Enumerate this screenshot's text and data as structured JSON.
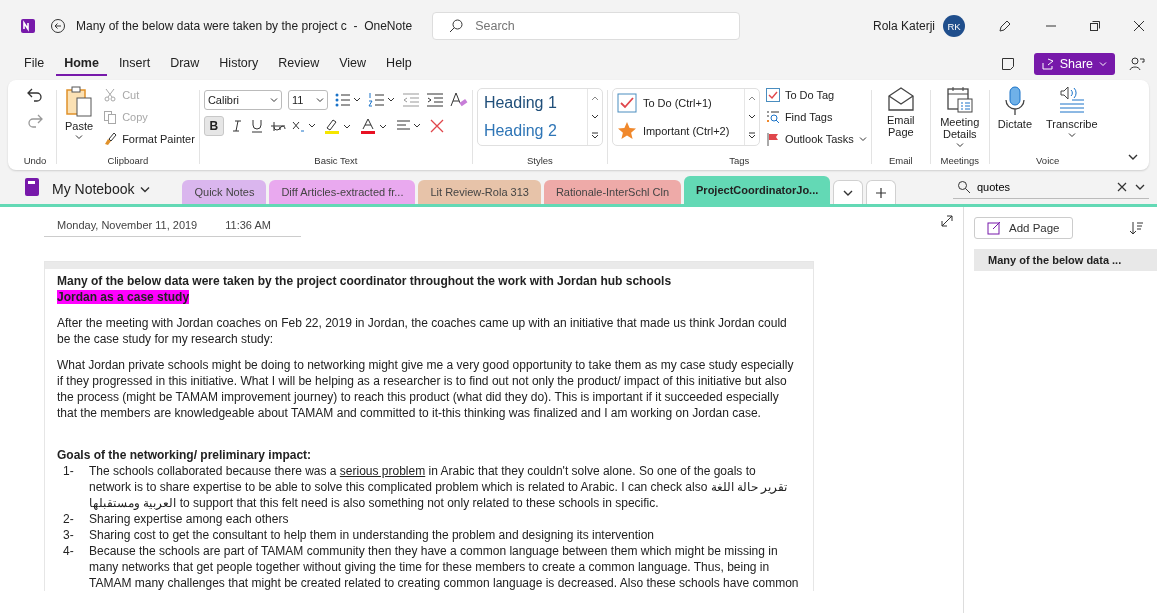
{
  "window": {
    "title": "Many of the below data were taken by the project c  -  OneNote",
    "user": "Rola Katerji",
    "avatar": "RK"
  },
  "search": {
    "placeholder": "Search"
  },
  "menu": [
    {
      "label": "File",
      "selected": false
    },
    {
      "label": "Home",
      "selected": true
    },
    {
      "label": "Insert",
      "selected": false
    },
    {
      "label": "Draw",
      "selected": false
    },
    {
      "label": "History",
      "selected": false
    },
    {
      "label": "Review",
      "selected": false
    },
    {
      "label": "View",
      "selected": false
    },
    {
      "label": "Help",
      "selected": false
    }
  ],
  "share": "Share",
  "undo": {
    "label": "Undo"
  },
  "clipboard": {
    "label": "Clipboard",
    "paste": "Paste",
    "items": [
      {
        "label": "Cut",
        "kind": "cut",
        "disabled": true
      },
      {
        "label": "Copy",
        "kind": "copy",
        "disabled": true
      },
      {
        "label": "Format Painter",
        "kind": "painter",
        "disabled": false
      }
    ]
  },
  "basic_text": {
    "label": "Basic Text",
    "font": "Calibri",
    "size": "11",
    "bold_label": "B",
    "bold_on": true
  },
  "styles": {
    "label": "Styles",
    "items": [
      "Heading 1",
      "Heading 2"
    ]
  },
  "tags": {
    "label": "Tags",
    "gallery": [
      {
        "label": "To Do (Ctrl+1)",
        "kind": "checkbox"
      },
      {
        "label": "Important (Ctrl+2)",
        "kind": "star"
      }
    ],
    "commands": [
      {
        "label": "To Do Tag",
        "kind": "todo"
      },
      {
        "label": "Find Tags",
        "kind": "find"
      },
      {
        "label": "Outlook Tasks",
        "kind": "flag"
      }
    ]
  },
  "email": {
    "label": "Email",
    "button": "Email Page"
  },
  "meetings": {
    "label": "Meetings",
    "button": "Meeting Details"
  },
  "voice": {
    "label": "Voice",
    "buttons": [
      {
        "label": "Dictate",
        "kind": "mic"
      },
      {
        "label": "Transcribe",
        "kind": "transcribe"
      }
    ]
  },
  "notebook": {
    "name": "My Notebook",
    "sections": [
      {
        "label": "Quick Notes",
        "color": "#dab6ee",
        "selected": false
      },
      {
        "label": "Diff Articles-extracted fr...",
        "color": "#e9a9ef",
        "selected": false
      },
      {
        "label": "Lit Review-Rola 313",
        "color": "#e7c3a9",
        "selected": false
      },
      {
        "label": "Rationale-InterSchl Cln",
        "color": "#eeaaa8",
        "selected": false
      },
      {
        "label": "ProjectCoordinatorJo...",
        "color": "#63d9b5",
        "selected": true
      }
    ]
  },
  "page_search": {
    "value": "quotes"
  },
  "page": {
    "date": "Monday, November 11, 2019",
    "time": "11:36 AM",
    "title": "Many of the below data were taken by the project coordinator throughout the work with Jordan hub schools",
    "highlight": "Jordan as a case study",
    "paragraphs": [
      "After the meeting with Jordan coaches on Feb 22, 2019 in Jordan, the coaches came up with an initiative that made us think Jordan could be the case study for my research study:",
      "What Jordan private schools might be doing to networking might give me a very good opportunity to take them as my case study especially if they progressed in this initiative. What I will be helping as a researcher is to find out not only the product/ impact of this initiative but also the process (might be TAMAM improvement journey) to reach this product (what did they do). This is important if it succeeded especially that the members are knowledgeable about TAMAM and committed to it-this thinking was finalized and I am working on Jordan case."
    ],
    "goals_heading": "Goals of the networking/ preliminary impact:",
    "list": [
      {
        "number": "1-",
        "parts": [
          {
            "text": "The schools collaborated because there was a ",
            "underline": false
          },
          {
            "text": "serious problem",
            "underline": true
          },
          {
            "text": " in Arabic that they couldn't solve alone. So one of the goals to network is to share expertise to be able to solve this complicated problem which is related to Arabic. I can check also ‫تقرير حالة اللغة العربية ومستقبلها‬ to support that this felt need is also something not only related to these schools in specific.",
            "underline": false
          }
        ]
      },
      {
        "number": "2-",
        "parts": [
          {
            "text": "Sharing expertise among each others",
            "underline": false
          }
        ]
      },
      {
        "number": "3-",
        "parts": [
          {
            "text": "Sharing cost to get the consultant to help them in understanding the problem and designing its intervention",
            "underline": false
          }
        ]
      },
      {
        "number": "4-",
        "parts": [
          {
            "text": "Because the schools are part of TAMAM community then they have a common language between them which might be missing in many networks that get people together without giving the time for these members to create a common language. Thus,  being in TAMAM many challenges that might be created related to creating common language is decreased. Also these schools have common",
            "underline": false
          }
        ]
      }
    ]
  },
  "pages_pane": {
    "add_page": "Add Page",
    "pages": [
      {
        "label": "Many of the below data ...",
        "selected": true
      }
    ]
  }
}
